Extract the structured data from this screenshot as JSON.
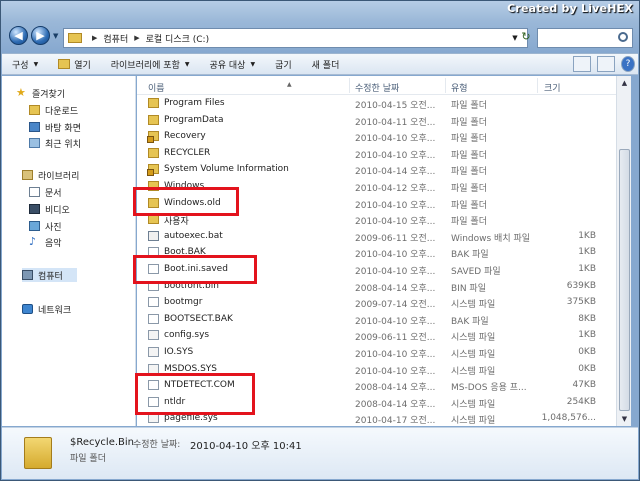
{
  "watermark": "Created by LiveHEX",
  "address": {
    "crumbs": [
      "컴퓨터",
      "로컬 디스크 (C:)"
    ]
  },
  "toolbar": {
    "items": [
      {
        "label": "구성",
        "dropdown": true
      },
      {
        "label": "열기",
        "dropdown": false
      },
      {
        "label": "라이브러리에 포함",
        "dropdown": true
      },
      {
        "label": "공유 대상",
        "dropdown": true
      },
      {
        "label": "굽기",
        "dropdown": false
      },
      {
        "label": "새 폴더",
        "dropdown": false
      }
    ]
  },
  "navpane": {
    "favorites": {
      "label": "즐겨찾기",
      "items": [
        "다운로드",
        "바탕 화면",
        "최근 위치"
      ]
    },
    "libraries": {
      "label": "라이브러리",
      "items": [
        "문서",
        "비디오",
        "사진",
        "음악"
      ]
    },
    "computer": "컴퓨터",
    "network": "네트워크"
  },
  "columns": {
    "name": "이름",
    "date": "수정한 날짜",
    "type": "유형",
    "size": "크기"
  },
  "files": [
    {
      "icon": "folder",
      "name": "Program Files",
      "date": "2010-04-15 오전...",
      "type": "파일 폴더",
      "size": ""
    },
    {
      "icon": "folder",
      "name": "ProgramData",
      "date": "2010-04-11 오전...",
      "type": "파일 폴더",
      "size": ""
    },
    {
      "icon": "lock",
      "name": "Recovery",
      "date": "2010-04-10 오후...",
      "type": "파일 폴더",
      "size": ""
    },
    {
      "icon": "folder",
      "name": "RECYCLER",
      "date": "2010-04-10 오후...",
      "type": "파일 폴더",
      "size": ""
    },
    {
      "icon": "lock",
      "name": "System Volume Information",
      "date": "2010-04-14 오후...",
      "type": "파일 폴더",
      "size": ""
    },
    {
      "icon": "folder",
      "name": "Windows",
      "date": "2010-04-12 오후...",
      "type": "파일 폴더",
      "size": ""
    },
    {
      "icon": "folder",
      "name": "Windows.old",
      "date": "2010-04-10 오후...",
      "type": "파일 폴더",
      "size": ""
    },
    {
      "icon": "folder",
      "name": "사용자",
      "date": "2010-04-10 오후...",
      "type": "파일 폴더",
      "size": ""
    },
    {
      "icon": "bat",
      "name": "autoexec.bat",
      "date": "2009-06-11 오전...",
      "type": "Windows 배치 파일",
      "size": "1KB"
    },
    {
      "icon": "file",
      "name": "Boot.BAK",
      "date": "2010-04-10 오후...",
      "type": "BAK 파일",
      "size": "1KB"
    },
    {
      "icon": "file",
      "name": "Boot.ini.saved",
      "date": "2010-04-10 오후...",
      "type": "SAVED 파일",
      "size": "1KB"
    },
    {
      "icon": "file",
      "name": "bootfont.bin",
      "date": "2008-04-14 오후...",
      "type": "BIN 파일",
      "size": "639KB"
    },
    {
      "icon": "file",
      "name": "bootmgr",
      "date": "2009-07-14 오전...",
      "type": "시스템 파일",
      "size": "375KB"
    },
    {
      "icon": "file",
      "name": "BOOTSECT.BAK",
      "date": "2010-04-10 오후...",
      "type": "BAK 파일",
      "size": "8KB"
    },
    {
      "icon": "sys",
      "name": "config.sys",
      "date": "2009-06-11 오전...",
      "type": "시스템 파일",
      "size": "1KB"
    },
    {
      "icon": "sys",
      "name": "IO.SYS",
      "date": "2010-04-10 오후...",
      "type": "시스템 파일",
      "size": "0KB"
    },
    {
      "icon": "sys",
      "name": "MSDOS.SYS",
      "date": "2010-04-10 오후...",
      "type": "시스템 파일",
      "size": "0KB"
    },
    {
      "icon": "file",
      "name": "NTDETECT.COM",
      "date": "2008-04-14 오후...",
      "type": "MS-DOS 응용 프...",
      "size": "47KB"
    },
    {
      "icon": "file",
      "name": "ntldr",
      "date": "2008-04-14 오후...",
      "type": "시스템 파일",
      "size": "254KB"
    },
    {
      "icon": "sys",
      "name": "pagefile.sys",
      "date": "2010-04-17 오전...",
      "type": "시스템 파일",
      "size": "1,048,576..."
    }
  ],
  "details": {
    "name": "$Recycle.Bin",
    "date_label": "수정한 날짜:",
    "date": "2010-04-10 오후 10:41",
    "type": "파일 폴더"
  },
  "colors": {
    "highlight": "#e3131d",
    "folder": "#e6c452"
  }
}
